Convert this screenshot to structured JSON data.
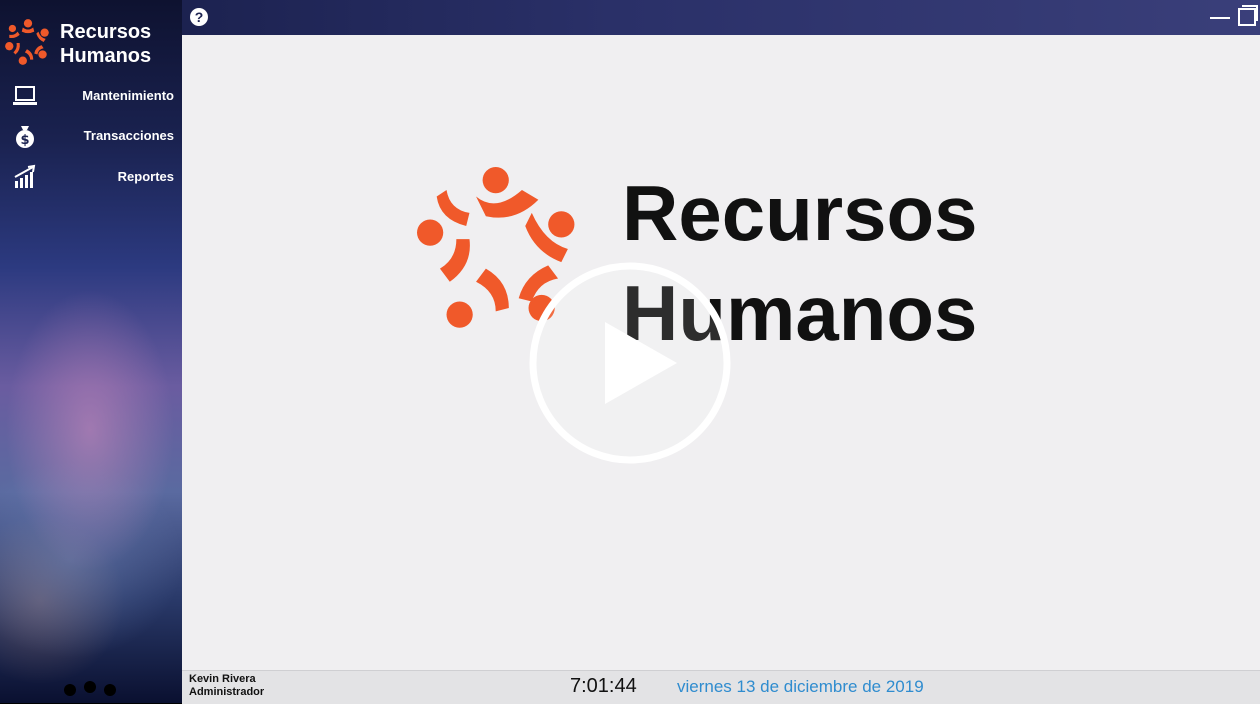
{
  "app": {
    "brand_title_line1": "Recursos",
    "brand_title_line2": "Humanos"
  },
  "sidebar": {
    "items": [
      {
        "label": "Mantenimiento",
        "icon": "laptop-icon"
      },
      {
        "label": "Transacciones",
        "icon": "money-bag-icon"
      },
      {
        "label": "Reportes",
        "icon": "bar-chart-icon"
      }
    ]
  },
  "topbar": {
    "help_icon": "question-icon",
    "help_text": "?"
  },
  "main": {
    "hero_title_line1": "Recursos",
    "hero_title_line2": "Humanos",
    "play_icon": "play-icon"
  },
  "statusbar": {
    "user_name": "Kevin Rivera",
    "user_role": "Administrador",
    "time": "7:01:44",
    "date": "viernes 13 de diciembre de 2019"
  },
  "colors": {
    "accent_orange": "#f0592a",
    "date_blue": "#2f8ccf",
    "sidebar_dark": "#0e1230",
    "content_bg": "#f0eff1"
  }
}
